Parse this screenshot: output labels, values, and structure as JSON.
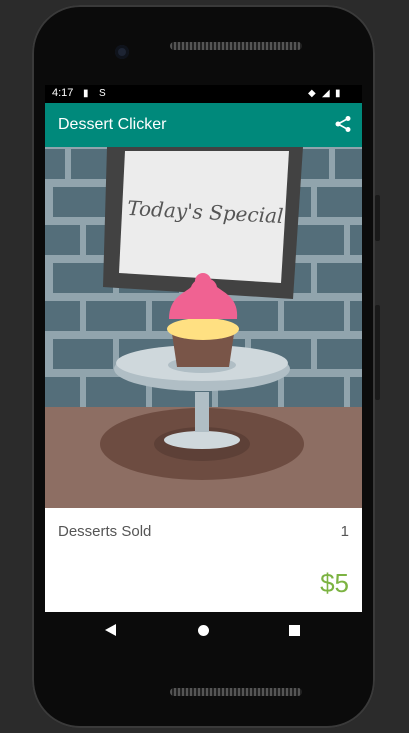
{
  "status_bar": {
    "time": "4:17",
    "icons": [
      "sd-card-icon",
      "s-notification-icon",
      "wifi-icon",
      "signal-icon",
      "battery-icon"
    ]
  },
  "app_bar": {
    "title": "Dessert Clicker",
    "share_icon": "share-icon",
    "color": "#00897b"
  },
  "scene": {
    "sign_text": "Today's Special",
    "dessert": "cupcake"
  },
  "stats": {
    "desserts_sold_label": "Desserts Sold",
    "desserts_sold_value": "1",
    "revenue": "$5",
    "revenue_color": "#7cb342"
  },
  "nav_bar": {
    "buttons": [
      "back-icon",
      "home-icon",
      "recents-icon"
    ]
  }
}
